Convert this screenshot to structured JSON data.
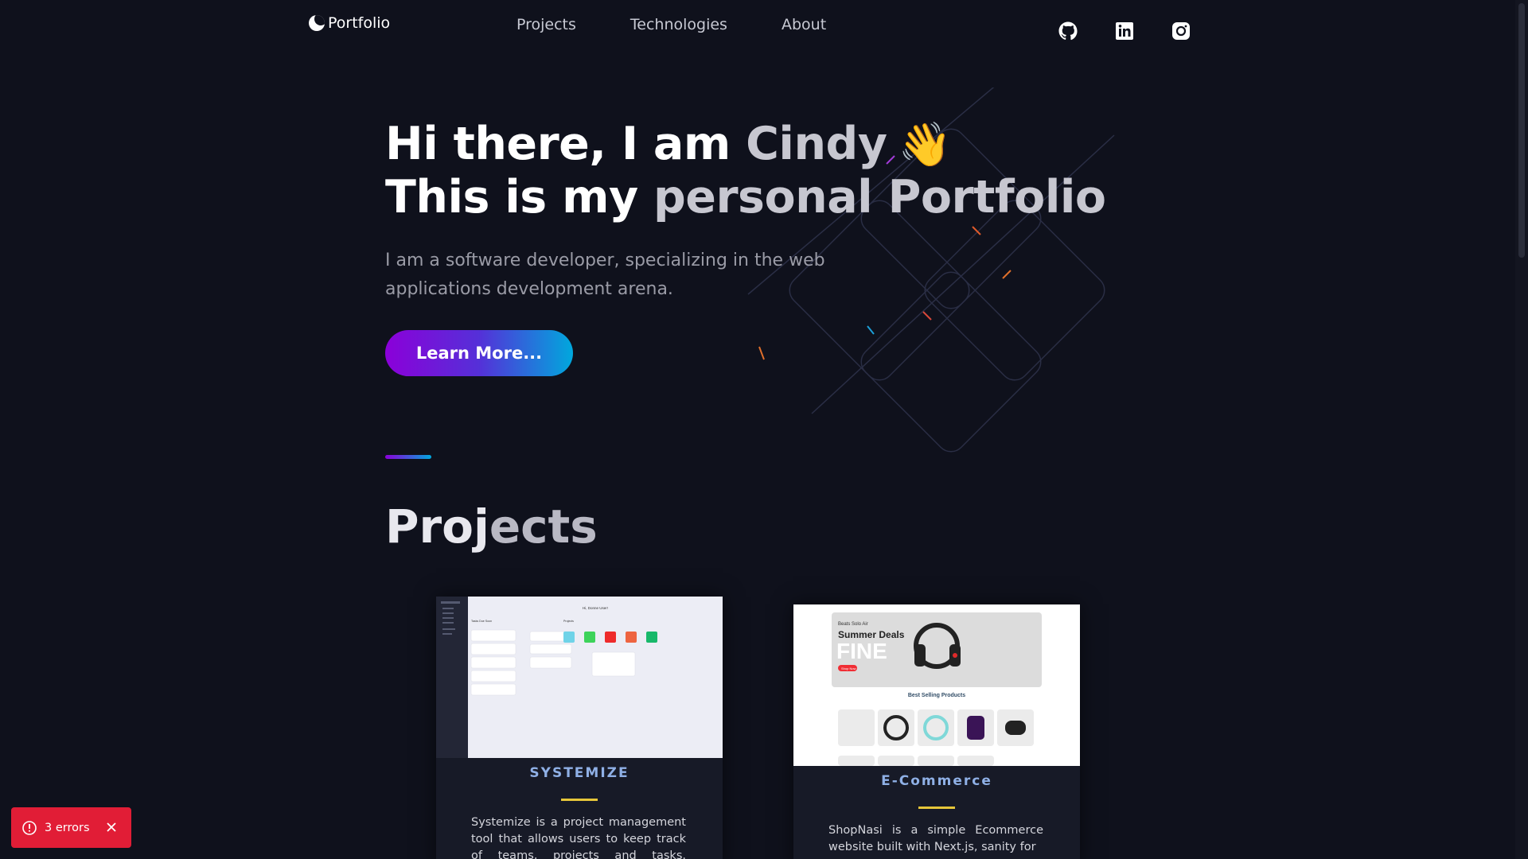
{
  "nav": {
    "brand": "Portfolio",
    "links": [
      "Projects",
      "Technologies",
      "About"
    ],
    "social": [
      "github-icon",
      "linkedin-icon",
      "instagram-icon"
    ]
  },
  "hero": {
    "line1_a": "Hi there, I am ",
    "line1_b": "Cindy",
    "line1_emoji": "👋",
    "line2_a": "This is my ",
    "line2_b": "personal Portfolio",
    "subtitle": "I am a software developer, specializing in the web applications development arena.",
    "cta": "Learn More..."
  },
  "projects": {
    "title_a": "Proj",
    "title_b": "ects",
    "cards": [
      {
        "title": "SYSTEMIZE",
        "desc": "Systemize is a project management tool that allows users to keep track of teams, projects and tasks. Systemize",
        "thumb": {
          "greeting": "Hi, Donne User!",
          "list_title": "Tasks Due Soon",
          "grid_title": "Projects"
        }
      },
      {
        "title": "E-Commerce",
        "desc": "ShopNasi is a simple Ecommerce website built with Next.js, sanity for",
        "thumb": {
          "banner_small": "Beats Solo Air",
          "banner_title": "Summer Deals",
          "banner_big": "FINE",
          "banner_button": "Shop Now",
          "section_title": "Best Selling Products"
        }
      }
    ]
  },
  "toast": {
    "text": "3 errors"
  },
  "colors": {
    "background": "#0f111c",
    "accent_start": "#8b00d9",
    "accent_end": "#00a8dd",
    "error": "#e11d36",
    "card_title": "#8fb0e6",
    "card_bar": "#e6c63a"
  }
}
